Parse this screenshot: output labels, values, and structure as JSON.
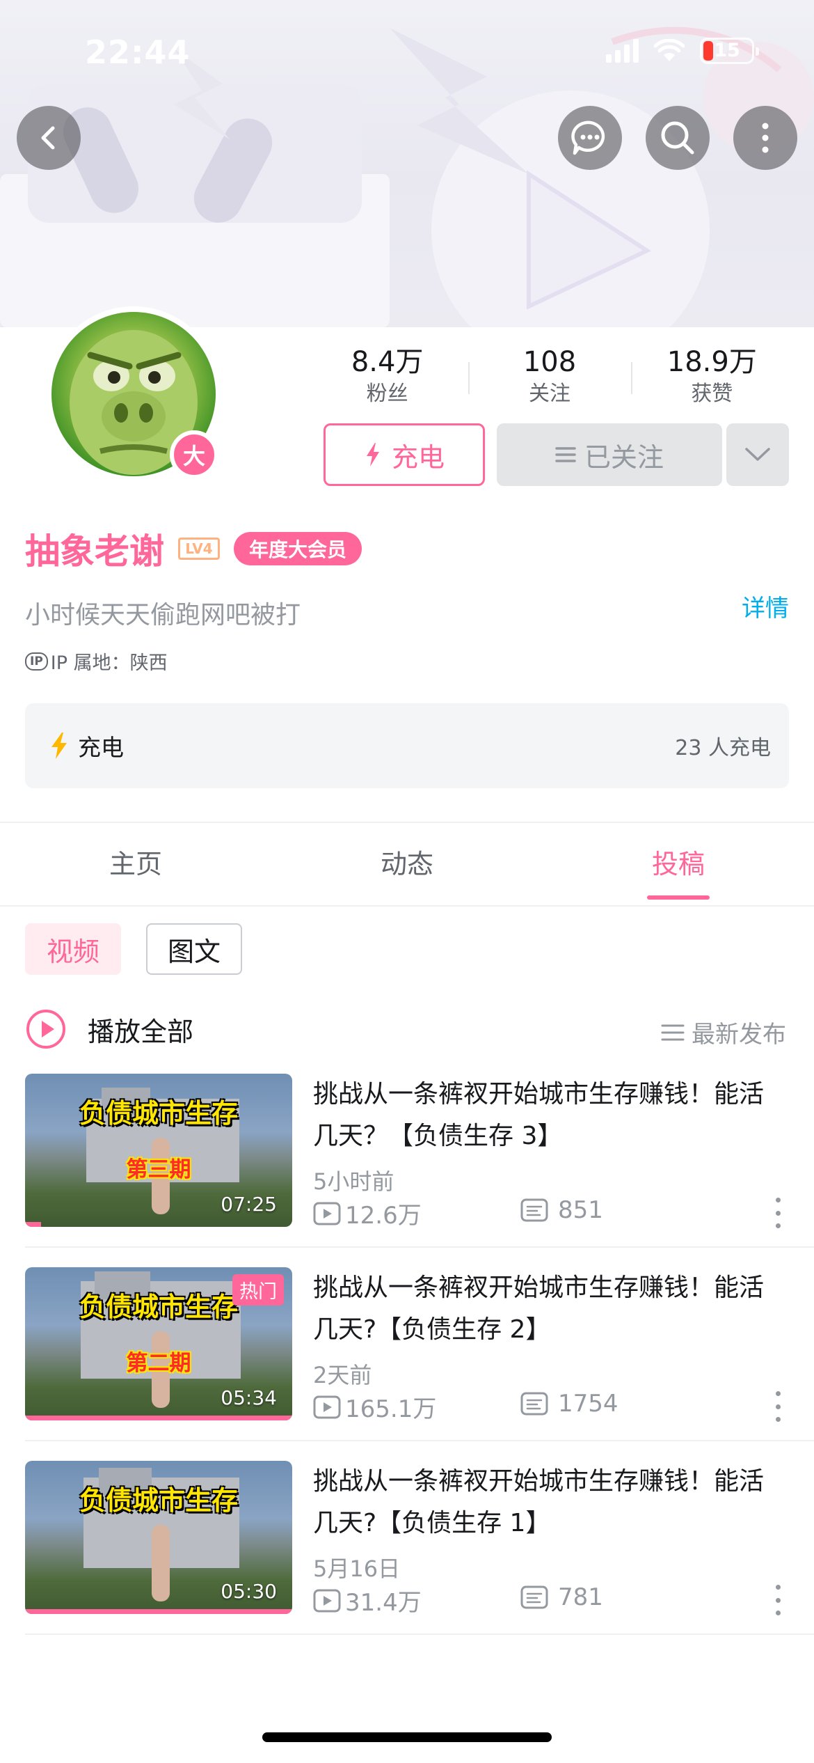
{
  "status_bar": {
    "time": "22:44",
    "battery": "15"
  },
  "header": {
    "back_icon": "back-chevron-icon",
    "message_icon": "message-icon",
    "search_icon": "search-icon",
    "more_icon": "more-vertical-icon"
  },
  "profile": {
    "vip_badge": "大",
    "stats": [
      {
        "num": "8.4万",
        "label": "粉丝"
      },
      {
        "num": "108",
        "label": "关注"
      },
      {
        "num": "18.9万",
        "label": "获赞"
      }
    ],
    "charge_button": "充电",
    "followed_button": "已关注",
    "name": "抽象老谢",
    "level": "LV4",
    "vip_tag": "年度大会员",
    "sign": "小时候天天偷跑网吧被打",
    "detail_link": "详情",
    "ip_badge": "IP",
    "ip_text": "IP 属地：陕西"
  },
  "charge_bar": {
    "label": "充电",
    "count": "23 人充电"
  },
  "tabs": [
    {
      "label": "主页"
    },
    {
      "label": "动态"
    },
    {
      "label": "投稿"
    }
  ],
  "sub_tabs": {
    "video": "视频",
    "article": "图文"
  },
  "list_header": {
    "play_all": "播放全部",
    "sort": "最新发布"
  },
  "videos": [
    {
      "title": "挑战从一条裤衩开始城市生存赚钱！能活几天？【负债生存 3】",
      "caption1": "负债城市生存",
      "caption2": "第三期",
      "duration": "07:25",
      "date": "5小时前",
      "plays": "12.6万",
      "danmaku": "851",
      "hot": "",
      "progress": 0.06
    },
    {
      "title": "挑战从一条裤衩开始城市生存赚钱！能活几天?【负债生存 2】",
      "caption1": "负债城市生存",
      "caption2": "第二期",
      "duration": "05:34",
      "date": "2天前",
      "plays": "165.1万",
      "danmaku": "1754",
      "hot": "热门",
      "progress": 1.0
    },
    {
      "title": "挑战从一条裤衩开始城市生存赚钱！能活几天?【负债生存 1】",
      "caption1": "负债城市生存",
      "caption2": "",
      "duration": "05:30",
      "date": "5月16日",
      "plays": "31.4万",
      "danmaku": "781",
      "hot": "",
      "progress": 1.0
    }
  ],
  "colors": {
    "accent": "#ff6699",
    "link": "#00aeec",
    "muted": "#9499a0"
  }
}
